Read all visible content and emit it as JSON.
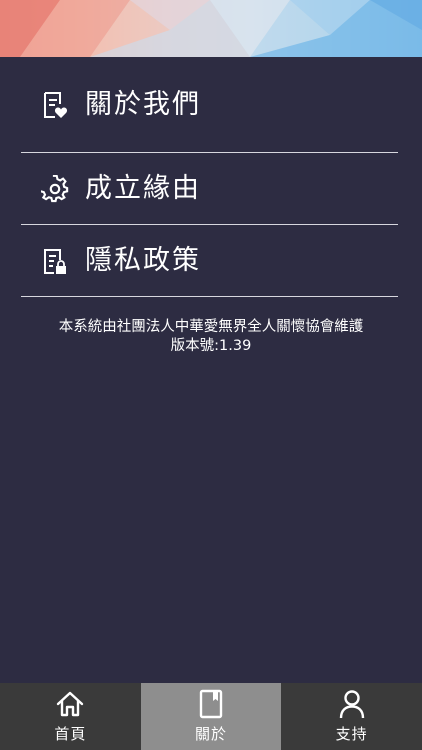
{
  "colors": {
    "background": "#2d2c42",
    "divider": "#d7d7de",
    "tabbar_bg": "#3a3a3a",
    "tab_active_bg": "#8e8e8e"
  },
  "menu": {
    "items": [
      {
        "label": "關於我們",
        "icon": "document-heart-icon"
      },
      {
        "label": "成立緣由",
        "icon": "gear-icon"
      },
      {
        "label": "隱私政策",
        "icon": "document-lock-icon"
      }
    ]
  },
  "footer_note": {
    "line1": "本系統由社團法人中華愛無界全人關懷協會維護",
    "line2": "版本號:1.39"
  },
  "tabbar": {
    "tabs": [
      {
        "label": "首頁",
        "icon": "home-icon"
      },
      {
        "label": "關於",
        "icon": "book-icon",
        "active": true
      },
      {
        "label": "支持",
        "icon": "person-icon"
      }
    ]
  }
}
